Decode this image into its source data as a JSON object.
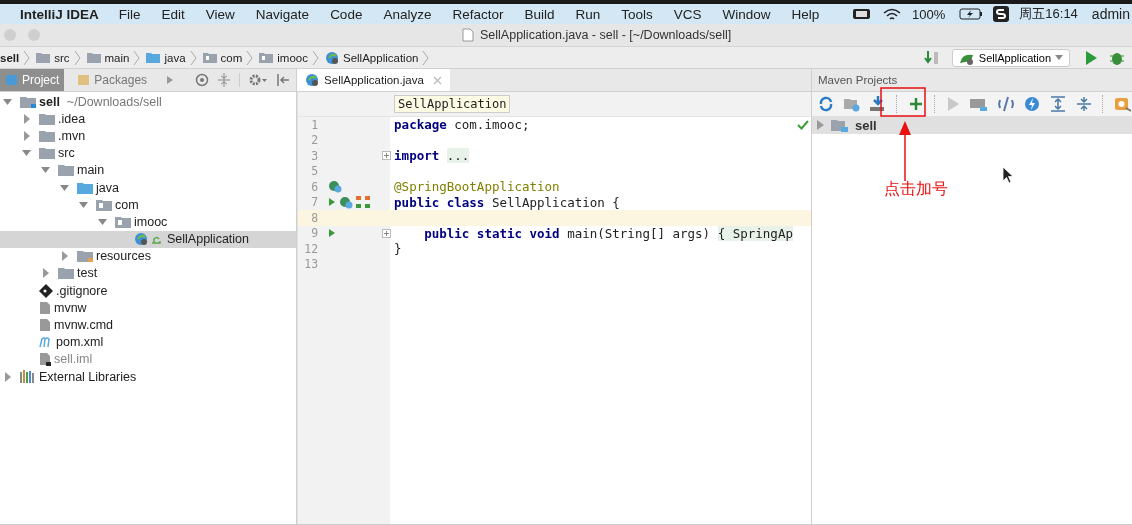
{
  "menubar": {
    "app": "IntelliJ IDEA",
    "items": [
      "File",
      "Edit",
      "View",
      "Navigate",
      "Code",
      "Analyze",
      "Refactor",
      "Build",
      "Run",
      "Tools",
      "VCS",
      "Window",
      "Help"
    ],
    "battery": "100%",
    "clock": "周五16:14",
    "user": "admin"
  },
  "window": {
    "title": "SellApplication.java - sell - [~/Downloads/sell]"
  },
  "breadcrumbs": [
    {
      "label": "sell",
      "kind": "project"
    },
    {
      "label": "src",
      "kind": "folder"
    },
    {
      "label": "main",
      "kind": "folder"
    },
    {
      "label": "java",
      "kind": "source"
    },
    {
      "label": "com",
      "kind": "package"
    },
    {
      "label": "imooc",
      "kind": "package"
    },
    {
      "label": "SellApplication",
      "kind": "class"
    }
  ],
  "run_config": {
    "label": "SellApplication"
  },
  "project_panel": {
    "tabs": [
      {
        "label": "Project",
        "selected": true
      },
      {
        "label": "Packages",
        "selected": false
      }
    ],
    "tree": [
      {
        "label": "sell",
        "detail": "~/Downloads/sell",
        "kind": "module",
        "expanded": true,
        "selected": false,
        "children": [
          {
            "label": ".idea",
            "kind": "folder",
            "expanded": false,
            "selected": false
          },
          {
            "label": ".mvn",
            "kind": "folder",
            "expanded": false,
            "selected": false
          },
          {
            "label": "src",
            "kind": "folder",
            "expanded": true,
            "selected": false,
            "children": [
              {
                "label": "main",
                "kind": "folder",
                "expanded": true,
                "selected": false,
                "children": [
                  {
                    "label": "java",
                    "kind": "source",
                    "expanded": true,
                    "selected": false,
                    "children": [
                      {
                        "label": "com",
                        "kind": "package",
                        "expanded": true,
                        "selected": false,
                        "children": [
                          {
                            "label": "imooc",
                            "kind": "package",
                            "expanded": true,
                            "selected": false,
                            "children": [
                              {
                                "label": "SellApplication",
                                "kind": "class",
                                "selected": true
                              }
                            ]
                          }
                        ]
                      }
                    ]
                  },
                  {
                    "label": "resources",
                    "kind": "resources",
                    "expanded": false,
                    "selected": false
                  }
                ]
              },
              {
                "label": "test",
                "kind": "folder",
                "expanded": false,
                "selected": false
              }
            ]
          },
          {
            "label": ".gitignore",
            "kind": "git",
            "selected": false
          },
          {
            "label": "mvnw",
            "kind": "file",
            "selected": false
          },
          {
            "label": "mvnw.cmd",
            "kind": "file",
            "selected": false
          },
          {
            "label": "pom.xml",
            "kind": "maven",
            "selected": false
          },
          {
            "label": "sell.iml",
            "kind": "iml",
            "selected": false
          }
        ]
      },
      {
        "label": "External Libraries",
        "kind": "libraries",
        "expanded": false,
        "selected": false
      }
    ]
  },
  "editor": {
    "tabs": [
      {
        "label": "SellApplication.java",
        "selected": true
      }
    ],
    "crumb": "SellApplication",
    "lines": [
      {
        "number": "1",
        "tokens": [
          {
            "text": "package",
            "kind": "keyword"
          },
          {
            "text": "com.imooc;",
            "kind": "plain"
          }
        ]
      },
      {
        "number": "2"
      },
      {
        "number": "3",
        "fold": true,
        "tokens": [
          {
            "text": "import",
            "kind": "keyword"
          },
          {
            "text": "...",
            "kind": "folded"
          }
        ]
      },
      {
        "number": "5"
      },
      {
        "number": "6",
        "bean_marker": true,
        "tokens": [
          {
            "text": "@SpringBootApplication",
            "kind": "annotation"
          }
        ]
      },
      {
        "number": "7",
        "run_marker": true,
        "bean_marker": true,
        "hierarchy_marker": true,
        "tokens": [
          {
            "text": "public class",
            "kind": "keyword"
          },
          {
            "text": "SellApplication {",
            "kind": "plain"
          }
        ]
      },
      {
        "number": "8",
        "current": true
      },
      {
        "number": "9",
        "run_marker": true,
        "fold": true,
        "nested": true,
        "tokens": [
          {
            "text": "public static void",
            "kind": "keyword"
          },
          {
            "text": "main(String[] args)",
            "kind": "plain"
          },
          {
            "text": "{ SpringAp",
            "kind": "folded"
          }
        ]
      },
      {
        "number": "12",
        "tokens": [
          {
            "text": "}",
            "kind": "plain"
          }
        ]
      },
      {
        "number": "13"
      }
    ]
  },
  "maven": {
    "title": "Maven Projects",
    "projects": [
      {
        "label": "sell",
        "expanded": false
      }
    ]
  },
  "annotation": {
    "label": "点击加号"
  }
}
